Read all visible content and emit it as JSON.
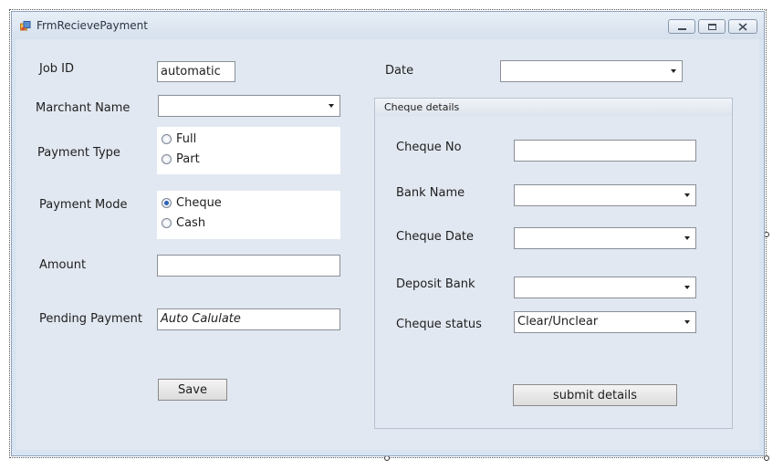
{
  "window": {
    "title": "FrmRecievePayment",
    "icon": "app-form-icon",
    "controls": {
      "minimize": "minimize-icon",
      "maximize": "maximize-icon",
      "close": "close-icon"
    }
  },
  "form": {
    "job_id": {
      "label": "Job  ID",
      "value": "automatic"
    },
    "merchant_name": {
      "label": "Marchant Name",
      "value": ""
    },
    "payment_type": {
      "label": "Payment Type",
      "options": [
        {
          "label": "Full",
          "checked": false
        },
        {
          "label": "Part",
          "checked": false
        }
      ]
    },
    "payment_mode": {
      "label": "Payment Mode",
      "options": [
        {
          "label": "Cheque",
          "checked": true
        },
        {
          "label": "Cash",
          "checked": false
        }
      ]
    },
    "amount": {
      "label": "Amount",
      "value": ""
    },
    "pending_payment": {
      "label": "Pending Payment",
      "value": "Auto Calulate"
    },
    "save_label": "Save",
    "date": {
      "label": "Date",
      "value": ""
    }
  },
  "cheque_details": {
    "title": "Cheque details",
    "cheque_no": {
      "label": "Cheque No",
      "value": ""
    },
    "bank_name": {
      "label": "Bank Name",
      "value": ""
    },
    "cheque_date": {
      "label": "Cheque Date",
      "value": ""
    },
    "deposit_bank": {
      "label": "Deposit Bank",
      "value": ""
    },
    "cheque_status": {
      "label": "Cheque status",
      "value": "Clear/Unclear"
    },
    "submit_label": "submit details"
  },
  "colors": {
    "client_bg": "#e2e8f1",
    "radio_checked": "#2d63b8"
  }
}
